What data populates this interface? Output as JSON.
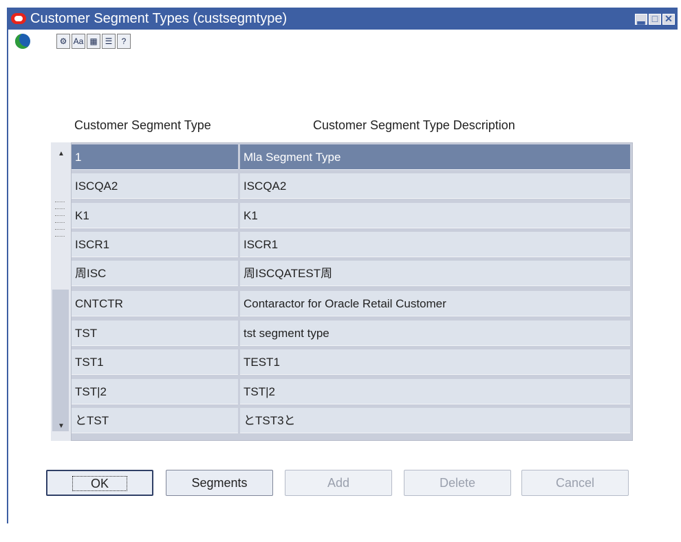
{
  "window": {
    "title": "Customer Segment Types  (custsegmtype)",
    "controls": {
      "minimize": "▂",
      "maximize": "□",
      "close": "✕"
    }
  },
  "toolbar": {
    "buttons": [
      {
        "name": "action-icon",
        "glyph": "⚙"
      },
      {
        "name": "translate-icon",
        "glyph": "Aa"
      },
      {
        "name": "calendar-icon",
        "glyph": "▦"
      },
      {
        "name": "notes-icon",
        "glyph": "☰"
      },
      {
        "name": "help-icon",
        "glyph": "?"
      }
    ]
  },
  "table": {
    "headers": [
      "Customer Segment Type",
      "Customer Segment Type Description"
    ],
    "rows": [
      {
        "type": "1",
        "description": "Mla Segment Type",
        "selected": true
      },
      {
        "type": "ISCQA2",
        "description": "ISCQA2"
      },
      {
        "type": "K1",
        "description": "K1"
      },
      {
        "type": "ISCR1",
        "description": "ISCR1"
      },
      {
        "type": "周ISC",
        "description": "周ISCQATEST周"
      },
      {
        "type": "CNTCTR",
        "description": "Contaractor for Oracle Retail Customer"
      },
      {
        "type": "TST",
        "description": "tst segment type"
      },
      {
        "type": "TST1",
        "description": "TEST1"
      },
      {
        "type": "TST|2",
        "description": "TST|2"
      },
      {
        "type": "とTST",
        "description": "とTST3と"
      }
    ]
  },
  "buttons": {
    "ok": "OK",
    "segments": "Segments",
    "add": "Add",
    "delete": "Delete",
    "cancel": "Cancel"
  },
  "colors": {
    "titlebar": "#3d5fa3",
    "selected_row": "#6f83a6",
    "cell": "#dde3ec"
  }
}
